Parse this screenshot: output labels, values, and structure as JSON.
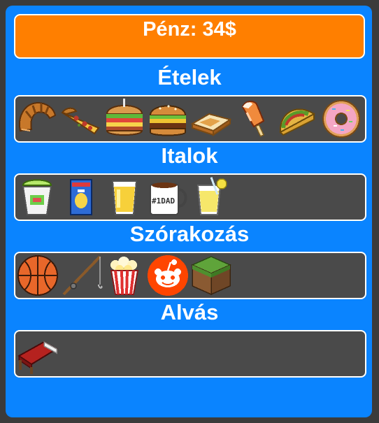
{
  "money": {
    "label": "Pénz: 34$"
  },
  "sections": [
    {
      "title": "Ételek",
      "items": [
        "croissant-icon",
        "pizza-slice-icon",
        "sandwich-icon",
        "burger-icon",
        "toast-icon",
        "popsicle-icon",
        "taco-icon",
        "donut-icon"
      ]
    },
    {
      "title": "Italok",
      "items": [
        "slushie-cup-icon",
        "juice-box-icon",
        "lemonade-glass-icon",
        "coffee-mug-icon",
        "lemon-drink-icon"
      ]
    },
    {
      "title": "Szórakozás",
      "items": [
        "basketball-icon",
        "fishing-rod-icon",
        "popcorn-icon",
        "reddit-icon",
        "grass-block-icon"
      ]
    },
    {
      "title": "Alvás",
      "items": [
        "bed-icon"
      ]
    }
  ],
  "colors": {
    "panel": "#0a84ff",
    "money_bar": "#ff7f00",
    "tray": "#4a4a4a",
    "page_background": "#3b3b3b"
  }
}
